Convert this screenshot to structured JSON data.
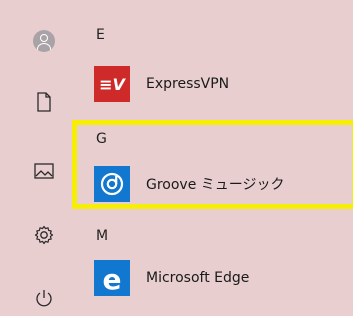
{
  "start_menu": {
    "rail": {
      "items": [
        {
          "icon": "user-avatar-icon"
        },
        {
          "icon": "document-icon"
        },
        {
          "icon": "pictures-icon"
        },
        {
          "icon": "settings-gear-icon"
        },
        {
          "icon": "power-icon"
        }
      ]
    },
    "sections": [
      {
        "letter": "E",
        "apps": [
          {
            "label": "ExpressVPN",
            "icon": "expressvpn-icon",
            "icon_color": "#cf2a2a"
          }
        ]
      },
      {
        "letter": "G",
        "apps": [
          {
            "label": "Groove ミュージック",
            "icon": "groove-music-icon",
            "icon_color": "#1277cf"
          }
        ]
      },
      {
        "letter": "M",
        "apps": [
          {
            "label": "Microsoft Edge",
            "icon": "edge-icon",
            "icon_color": "#1277cf"
          }
        ]
      }
    ],
    "highlight_color": "#f6ee06"
  }
}
